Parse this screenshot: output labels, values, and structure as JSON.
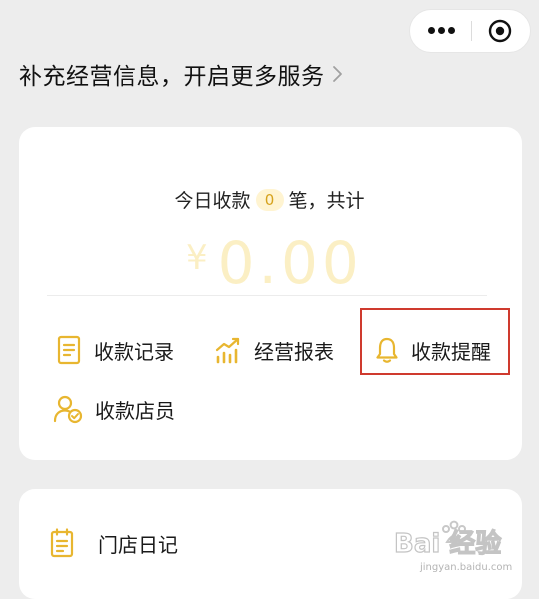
{
  "header": {
    "more_icon": "more-dots-icon",
    "close_icon": "target-circle-icon"
  },
  "headline": {
    "text": "补充经营信息，开启更多服务",
    "chevron_icon": "chevron-right-icon"
  },
  "summary": {
    "prefix": "今日收款",
    "count": "0",
    "suffix": "笔，共计",
    "currency": "¥",
    "amount": "0.00",
    "amount_color": "#fbefc4",
    "badge_color": "#d6a21c"
  },
  "actions": [
    {
      "label": "收款记录",
      "icon": "document-icon"
    },
    {
      "label": "经营报表",
      "icon": "chart-growth-icon"
    },
    {
      "label": "收款提醒",
      "icon": "bell-icon"
    },
    {
      "label": "收款店员",
      "icon": "staff-check-icon"
    }
  ],
  "accent_color": "#e8b630",
  "highlight_color": "#cf3a2e",
  "store": {
    "label": "门店日记",
    "icon": "notebook-icon"
  },
  "watermark": {
    "text": "Bai 经验",
    "subtext": "jingyan.baidu.com"
  }
}
